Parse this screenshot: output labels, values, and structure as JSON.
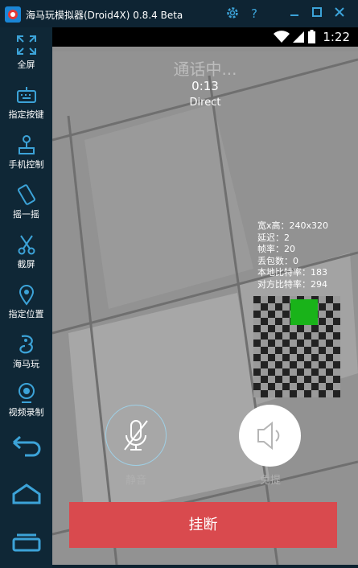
{
  "window": {
    "title": "海马玩模拟器(Droid4X) 0.8.4 Beta",
    "accent": "#3ca3d8"
  },
  "sidebar": {
    "items": [
      {
        "label": "全屏",
        "icon": "fullscreen-icon"
      },
      {
        "label": "指定按键",
        "icon": "keyboard-icon"
      },
      {
        "label": "手机控制",
        "icon": "joystick-icon"
      },
      {
        "label": "摇一摇",
        "icon": "shake-icon"
      },
      {
        "label": "截屏",
        "icon": "scissors-icon"
      },
      {
        "label": "指定位置",
        "icon": "location-pin-icon"
      },
      {
        "label": "海马玩",
        "icon": "haimawan-logo-icon"
      },
      {
        "label": "视频录制",
        "icon": "video-record-icon"
      }
    ],
    "nav": [
      "back-icon",
      "home-icon",
      "recent-apps-icon"
    ]
  },
  "statusbar": {
    "time": "1:22"
  },
  "call": {
    "status": "通话中...",
    "timer": "0:13",
    "mode": "Direct",
    "stats": [
      "宽x高：240x320",
      "延迟：2",
      "帧率：20",
      "丢包数：0",
      "本地比特率：183",
      "对方比特率：294"
    ],
    "mute_label": "静音",
    "speaker_label": "免提",
    "hangup_label": "挂断",
    "hangup_color": "#d94a4e"
  }
}
